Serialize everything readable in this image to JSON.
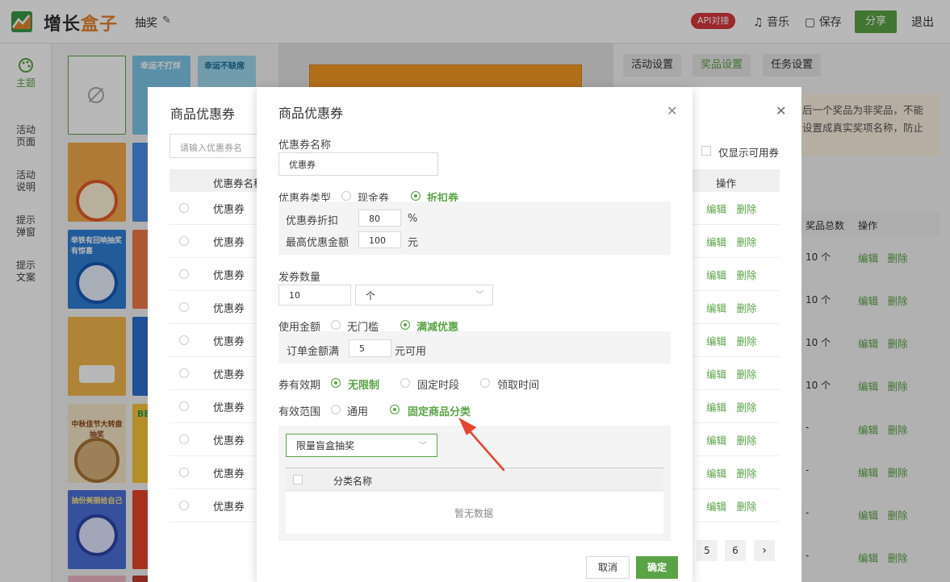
{
  "topbar": {
    "logo_prefix": "增长",
    "logo_suffix": "盒子",
    "page_title": "抽奖",
    "api_badge": "API对接",
    "music": "音乐",
    "save": "保存",
    "share": "分享",
    "exit": "退出"
  },
  "sidebar": {
    "items": [
      {
        "label": "主题",
        "icon": "palette-icon"
      },
      {
        "label": "活动页面"
      },
      {
        "label": "活动说明"
      },
      {
        "label": "提示弹窗"
      },
      {
        "label": "提示文案"
      }
    ]
  },
  "thumbs": {
    "texts": [
      "幸运不打烊",
      "幸运不缺席",
      "举铁有回响抽奖有惊喜",
      "中秋佳节大转盘抽奖",
      "抽份美丽给自己",
      "BE"
    ]
  },
  "right_panel": {
    "tabs": [
      "活动设置",
      "奖品设置",
      "任务设置"
    ],
    "tip": "后一个奖品为非奖品，不能设置成真实奖项名称，防止",
    "col_total": "奖品总数",
    "col_ops": "操作",
    "rows": [
      "10 个",
      "10 个",
      "10 个",
      "10 个",
      "-",
      "-",
      "-",
      "-",
      "-"
    ],
    "edit": "编辑",
    "delete": "删除"
  },
  "back_dialog": {
    "title": "商品优惠券",
    "search_placeholder": "请输入优惠券名",
    "only_available": "仅显示可用券",
    "col_name": "优惠券名称",
    "col_ops": "操作",
    "row_name": "优惠券",
    "edit": "编辑",
    "delete": "删除",
    "pages": [
      "5",
      "6",
      "›"
    ]
  },
  "dialog": {
    "title": "商品优惠券",
    "name_label": "优惠券名称",
    "name_value": "优惠券",
    "type_label": "优惠券类型",
    "type_cash": "现金券",
    "type_discount": "折扣券",
    "discount_label": "优惠券折扣",
    "discount_value": "80",
    "discount_unit": "%",
    "max_label": "最高优惠金额",
    "max_value": "100",
    "max_unit": "元",
    "qty_label": "发券数量",
    "qty_value": "10",
    "qty_unit": "个",
    "amount_label": "使用金额",
    "amount_none": "无门槛",
    "amount_full": "满减优惠",
    "order_label": "订单金额满",
    "order_value": "5",
    "order_unit": "元可用",
    "valid_label": "券有效期",
    "valid_unlimited": "无限制",
    "valid_fixed": "固定时段",
    "valid_receive": "领取时间",
    "scope_label": "有效范围",
    "scope_general": "通用",
    "scope_category": "固定商品分类",
    "category_select": "限量盲盒抽奖",
    "category_col": "分类名称",
    "empty": "暂无数据",
    "cancel": "取消",
    "ok": "确定"
  },
  "colors": {
    "accent": "#5aa346",
    "badge": "#d9363e",
    "arrow": "#e8432d"
  }
}
